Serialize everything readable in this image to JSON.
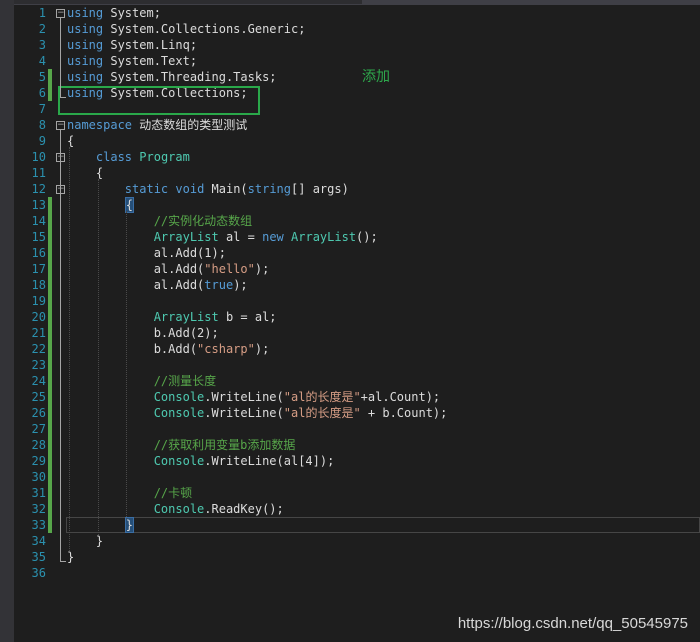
{
  "editor": {
    "line_numbers": [
      "1",
      "2",
      "3",
      "4",
      "5",
      "6",
      "7",
      "8",
      "9",
      "10",
      "11",
      "12",
      "13",
      "14",
      "15",
      "16",
      "17",
      "18",
      "19",
      "20",
      "21",
      "22",
      "23",
      "24",
      "25",
      "26",
      "27",
      "28",
      "29",
      "30",
      "31",
      "32",
      "33",
      "34",
      "35",
      "36"
    ],
    "lines": [
      [
        {
          "t": "using",
          "c": "kw"
        },
        {
          "t": " System;",
          "c": "pl"
        }
      ],
      [
        {
          "t": "using",
          "c": "kw"
        },
        {
          "t": " System.Collections.Generic;",
          "c": "pl"
        }
      ],
      [
        {
          "t": "using",
          "c": "kw"
        },
        {
          "t": " System.Linq;",
          "c": "pl"
        }
      ],
      [
        {
          "t": "using",
          "c": "kw"
        },
        {
          "t": " System.Text;",
          "c": "pl"
        }
      ],
      [
        {
          "t": "using",
          "c": "kw"
        },
        {
          "t": " System.Threading.Tasks;",
          "c": "pl"
        }
      ],
      [
        {
          "t": "using",
          "c": "kw"
        },
        {
          "t": " System.Collections;",
          "c": "pl"
        }
      ],
      [],
      [
        {
          "t": "namespace",
          "c": "kw"
        },
        {
          "t": " 动态数组的类型测试",
          "c": "pl"
        }
      ],
      [
        {
          "t": "{",
          "c": "pl"
        }
      ],
      [
        {
          "t": "    ",
          "c": "pl"
        },
        {
          "t": "class",
          "c": "kw"
        },
        {
          "t": " ",
          "c": "pl"
        },
        {
          "t": "Program",
          "c": "ty"
        }
      ],
      [
        {
          "t": "    {",
          "c": "pl"
        }
      ],
      [
        {
          "t": "        ",
          "c": "pl"
        },
        {
          "t": "static",
          "c": "kw"
        },
        {
          "t": " ",
          "c": "pl"
        },
        {
          "t": "void",
          "c": "kw"
        },
        {
          "t": " Main(",
          "c": "pl"
        },
        {
          "t": "string",
          "c": "kw"
        },
        {
          "t": "[] args)",
          "c": "pl"
        }
      ],
      [
        {
          "t": "        ",
          "c": "pl"
        },
        {
          "t": "{",
          "c": "brace"
        }
      ],
      [
        {
          "t": "            ",
          "c": "pl"
        },
        {
          "t": "//实例化动态数组",
          "c": "cm"
        }
      ],
      [
        {
          "t": "            ",
          "c": "pl"
        },
        {
          "t": "ArrayList",
          "c": "ty"
        },
        {
          "t": " al = ",
          "c": "pl"
        },
        {
          "t": "new",
          "c": "kw"
        },
        {
          "t": " ",
          "c": "pl"
        },
        {
          "t": "ArrayList",
          "c": "ty"
        },
        {
          "t": "();",
          "c": "pl"
        }
      ],
      [
        {
          "t": "            al.Add(1);",
          "c": "pl"
        }
      ],
      [
        {
          "t": "            al.Add(",
          "c": "pl"
        },
        {
          "t": "\"hello\"",
          "c": "str"
        },
        {
          "t": ");",
          "c": "pl"
        }
      ],
      [
        {
          "t": "            al.Add(",
          "c": "pl"
        },
        {
          "t": "true",
          "c": "kw"
        },
        {
          "t": ");",
          "c": "pl"
        }
      ],
      [],
      [
        {
          "t": "            ",
          "c": "pl"
        },
        {
          "t": "ArrayList",
          "c": "ty"
        },
        {
          "t": " b = al;",
          "c": "pl"
        }
      ],
      [
        {
          "t": "            b.Add(2);",
          "c": "pl"
        }
      ],
      [
        {
          "t": "            b.Add(",
          "c": "pl"
        },
        {
          "t": "\"csharp\"",
          "c": "str"
        },
        {
          "t": ");",
          "c": "pl"
        }
      ],
      [],
      [
        {
          "t": "            ",
          "c": "pl"
        },
        {
          "t": "//测量长度",
          "c": "cm"
        }
      ],
      [
        {
          "t": "            ",
          "c": "pl"
        },
        {
          "t": "Console",
          "c": "ty"
        },
        {
          "t": ".WriteLine(",
          "c": "pl"
        },
        {
          "t": "\"al的长度是\"",
          "c": "str"
        },
        {
          "t": "+al.Count);",
          "c": "pl"
        }
      ],
      [
        {
          "t": "            ",
          "c": "pl"
        },
        {
          "t": "Console",
          "c": "ty"
        },
        {
          "t": ".WriteLine(",
          "c": "pl"
        },
        {
          "t": "\"al的长度是\"",
          "c": "str"
        },
        {
          "t": " + b.Count);",
          "c": "pl"
        }
      ],
      [],
      [
        {
          "t": "            ",
          "c": "pl"
        },
        {
          "t": "//获取利用变量b添加数据",
          "c": "cm"
        }
      ],
      [
        {
          "t": "            ",
          "c": "pl"
        },
        {
          "t": "Console",
          "c": "ty"
        },
        {
          "t": ".WriteLine(al[4]);",
          "c": "pl"
        }
      ],
      [],
      [
        {
          "t": "            ",
          "c": "pl"
        },
        {
          "t": "//卡顿",
          "c": "cm"
        }
      ],
      [
        {
          "t": "            ",
          "c": "pl"
        },
        {
          "t": "Console",
          "c": "ty"
        },
        {
          "t": ".ReadKey();",
          "c": "pl"
        }
      ],
      [
        {
          "t": "        ",
          "c": "pl"
        },
        {
          "t": "}",
          "c": "brace"
        }
      ],
      [
        {
          "t": "    }",
          "c": "pl"
        }
      ],
      [
        {
          "t": "}",
          "c": "pl"
        }
      ],
      []
    ],
    "changed_lines": [
      5,
      6,
      13,
      14,
      15,
      16,
      17,
      18,
      19,
      20,
      21,
      22,
      23,
      24,
      25,
      26,
      27,
      28,
      29,
      30,
      31,
      32,
      33
    ],
    "fold_markers": [
      1,
      8,
      10,
      12
    ],
    "current_line": 33
  },
  "annotation": {
    "label": "添加",
    "highlight_color": "#2aa84a"
  },
  "watermark": "https://blog.csdn.net/qq_50545975",
  "colors": {
    "keyword": "#569cd6",
    "type": "#4ec9b0",
    "string": "#d69d85",
    "comment": "#57a64a",
    "line_number": "#2b91af",
    "background": "#1e1e1e"
  }
}
